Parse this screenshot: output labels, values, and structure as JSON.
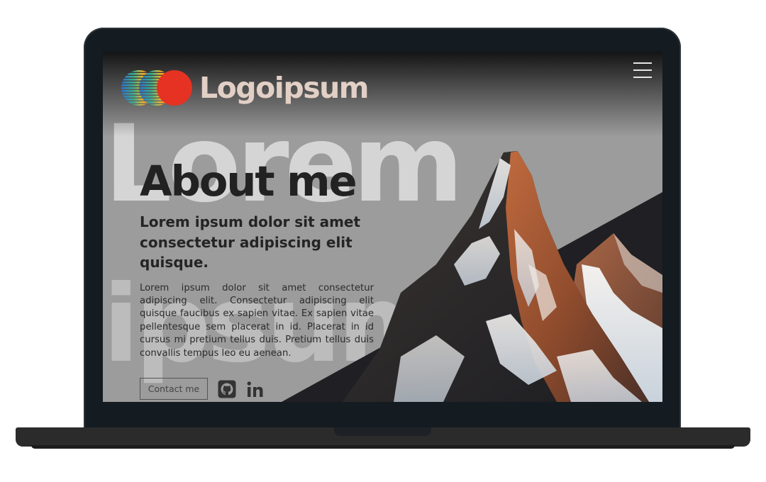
{
  "brand": {
    "name": "Logoipsum",
    "colors": {
      "logo_text": "#e2cfc5",
      "accent_red": "#e53222",
      "accent_yellow": "#f4b82b",
      "accent_blue": "#2a6fd6"
    }
  },
  "header": {
    "menu_icon": "hamburger-menu-icon"
  },
  "background_words": {
    "line1": "Lorem",
    "line2": "ipsum"
  },
  "hero": {
    "title": "About me",
    "subtitle": "Lorem ipsum dolor sit amet consectetur adipiscing elit quisque.",
    "body": "Lorem ipsum dolor sit amet consectetur adipiscing elit. Consectetur adipiscing elit quisque faucibus ex sapien vitae. Ex sapien vitae pellentesque sem placerat in id. Placerat in id cursus mi pretium tellus duis. Pretium tellus duis convallis tempus leo eu aenean."
  },
  "actions": {
    "contact_label": "Contact me",
    "icons": [
      "github-icon",
      "linkedin-icon"
    ]
  },
  "theme": {
    "background": "#9c9c9c",
    "dark_panel": "#1f1f24",
    "title_color": "#222222"
  }
}
